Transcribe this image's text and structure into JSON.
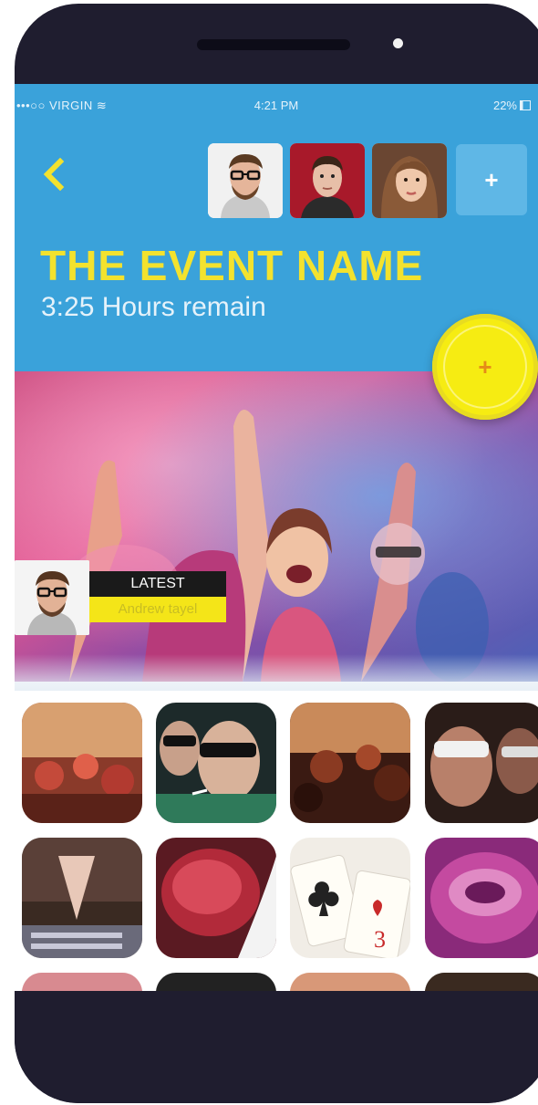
{
  "status_bar": {
    "carrier": "•••○○ VIRGIN ≋",
    "time": "4:21 PM",
    "battery": "22%"
  },
  "header": {
    "back_icon": "chevron-left-icon",
    "add_button_label": "+",
    "event_title": "THE EVENT NAME",
    "event_subtitle": "3:25 Hours remain",
    "fab_label": "+"
  },
  "latest": {
    "label": "LATEST",
    "name": "Andrew tayel"
  },
  "colors": {
    "header_bg": "#3aa2da",
    "accent_yellow": "#f3e22e",
    "phone_body": "#1f1d2f"
  }
}
